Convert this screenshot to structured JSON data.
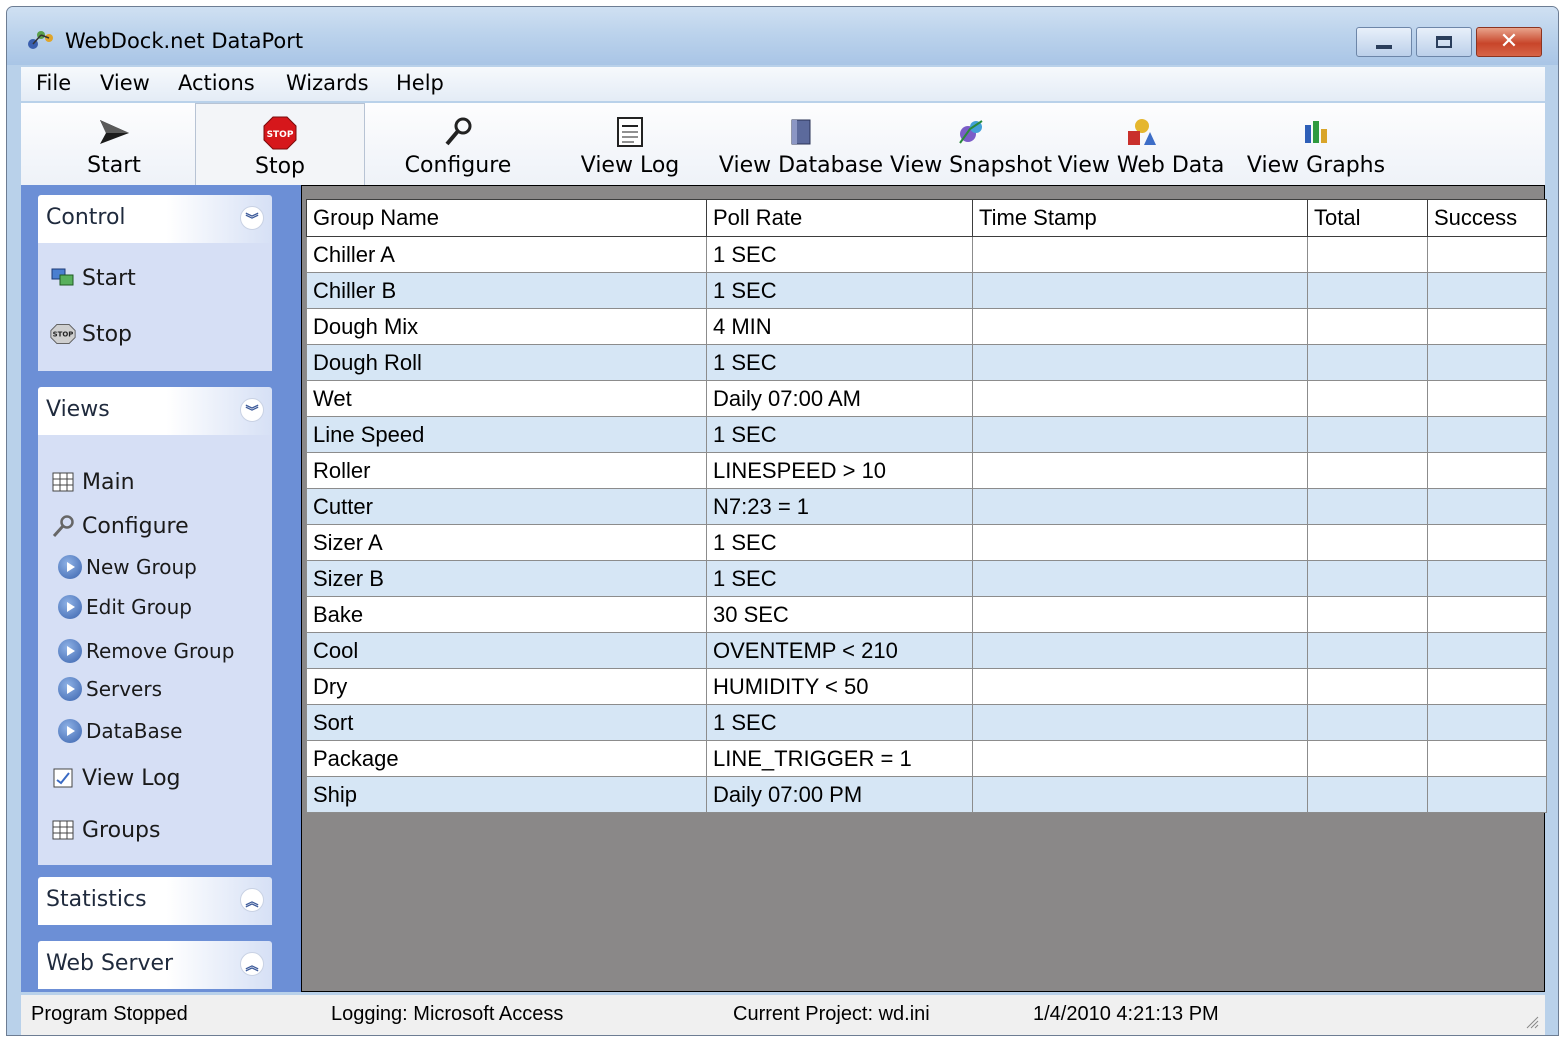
{
  "window": {
    "title": "WebDock.net DataPort",
    "close_glyph": "✕"
  },
  "menu": [
    "File",
    "View",
    "Actions",
    "Wizards",
    "Help"
  ],
  "toolbar": {
    "start": "Start",
    "stop": "Stop",
    "configure": "Configure",
    "view_log": "View Log",
    "view_database": "View Database",
    "view_snapshot": "View Snapshot",
    "view_web_data": "View Web Data",
    "view_graphs": "View Graphs"
  },
  "sidebar": {
    "control": {
      "title": "Control",
      "start": "Start",
      "stop": "Stop"
    },
    "views": {
      "title": "Views",
      "main": "Main",
      "configure": "Configure",
      "new_group": "New Group",
      "edit_group": "Edit Group",
      "remove_group": "Remove Group",
      "servers": "Servers",
      "database": "DataBase",
      "view_log": "View Log",
      "groups": "Groups"
    },
    "statistics": {
      "title": "Statistics"
    },
    "web_server": {
      "title": "Web Server"
    }
  },
  "table": {
    "columns": [
      "Group Name",
      "Poll Rate",
      "Time Stamp",
      "Total",
      "Success"
    ],
    "rows": [
      [
        "Chiller A",
        "1 SEC"
      ],
      [
        "Chiller B",
        "1 SEC"
      ],
      [
        "Dough Mix",
        "4 MIN"
      ],
      [
        "Dough Roll",
        "1 SEC"
      ],
      [
        "Wet",
        "Daily 07:00 AM"
      ],
      [
        "Line Speed",
        "1 SEC"
      ],
      [
        "Roller",
        "LINESPEED > 10"
      ],
      [
        "Cutter",
        "N7:23 = 1"
      ],
      [
        "Sizer A",
        "1 SEC"
      ],
      [
        "Sizer B",
        "1 SEC"
      ],
      [
        "Bake",
        "30 SEC"
      ],
      [
        "Cool",
        "OVENTEMP < 210"
      ],
      [
        "Dry",
        "HUMIDITY < 50"
      ],
      [
        "Sort",
        "1 SEC"
      ],
      [
        "Package",
        "LINE_TRIGGER = 1"
      ],
      [
        "Ship",
        "Daily 07:00 PM"
      ]
    ]
  },
  "status": {
    "program": "Program Stopped",
    "logging": "Logging: Microsoft Access",
    "project": "Current Project: wd.ini",
    "datetime": "1/4/2010 4:21:13 PM"
  },
  "colors": {
    "sidebar_bg": "#6c8fd6",
    "row_alt": "#d6e6f5",
    "grid_bg": "#8a8888",
    "stop_red": "#d6171b"
  }
}
